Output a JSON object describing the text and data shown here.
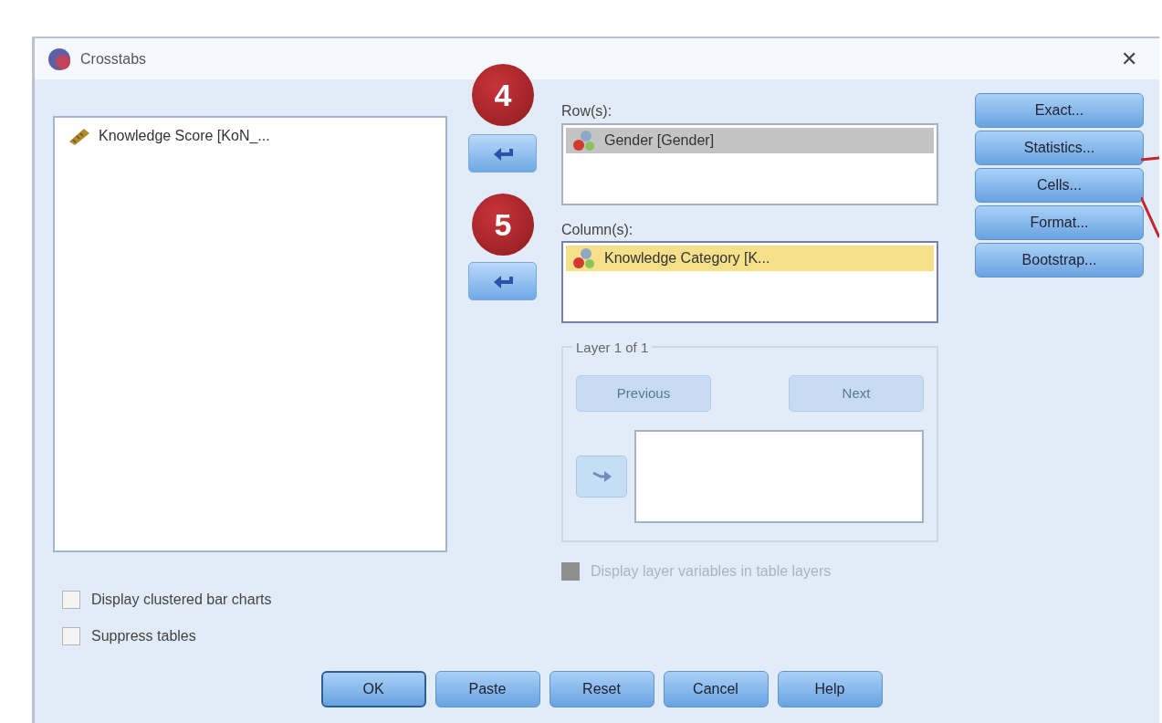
{
  "window": {
    "title": "Crosstabs",
    "close": "✕"
  },
  "source_list": {
    "items": [
      {
        "label": "Knowledge Score [KoN_...",
        "kind": "scale"
      }
    ]
  },
  "annotations": [
    {
      "label": "4"
    },
    {
      "label": "5"
    }
  ],
  "rows": {
    "label": "Row(s):",
    "focused": false,
    "items": [
      {
        "label": "Gender [Gender]",
        "kind": "nominal",
        "selected": true
      }
    ]
  },
  "columns": {
    "label": "Column(s):",
    "focused": true,
    "items": [
      {
        "label": "Knowledge Category [K...",
        "kind": "nominal",
        "selected": true
      }
    ]
  },
  "layer": {
    "title": "Layer 1 of 1",
    "previous": {
      "label": "Previous",
      "disabled": true
    },
    "next": {
      "label": "Next",
      "disabled": true
    },
    "arrow_disabled": true
  },
  "layer_option": {
    "label": "Display layer variables in table layers",
    "checked": false,
    "disabled": true
  },
  "options": [
    {
      "label": "Display clustered bar charts",
      "checked": false
    },
    {
      "label": "Suppress tables",
      "checked": false
    }
  ],
  "side_buttons": [
    "Exact...",
    "Statistics...",
    "Cells...",
    "Format...",
    "Bootstrap..."
  ],
  "footer_buttons": [
    {
      "label": "OK",
      "default": true
    },
    {
      "label": "Paste",
      "default": false
    },
    {
      "label": "Reset",
      "default": false
    },
    {
      "label": "Cancel",
      "default": false
    },
    {
      "label": "Help",
      "default": false
    }
  ]
}
